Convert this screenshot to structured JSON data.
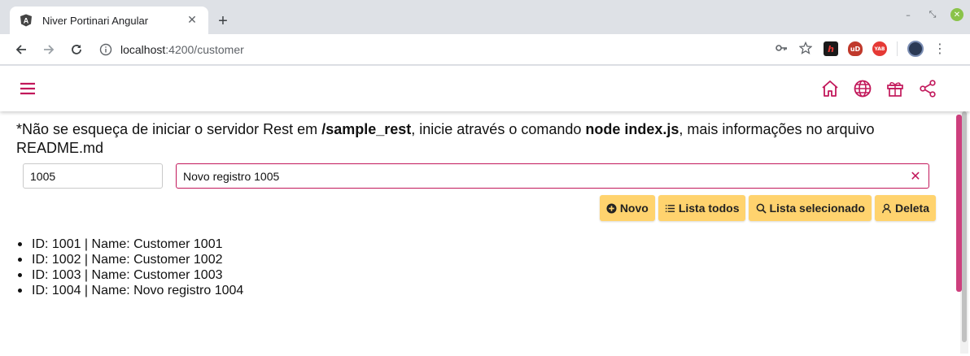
{
  "browser": {
    "tab_title": "Niver Portinari Angular",
    "tab_favicon": "angular-icon",
    "new_tab_label": "+",
    "url_host": "localhost",
    "url_path": ":4200/customer",
    "extensions": [
      {
        "name": "ext-h-icon",
        "label": "h",
        "color": "#1a1a1a"
      },
      {
        "name": "ublock-icon",
        "label": "uD",
        "color": "#c0392b"
      },
      {
        "name": "yab-icon",
        "label": "YAB",
        "color": "#e53935"
      }
    ]
  },
  "app": {
    "accent": "#c2185b",
    "appbar_icons": [
      "home-icon",
      "globe-icon",
      "gift-icon",
      "share-icon"
    ],
    "notice": {
      "prefix": "*Não se esqueça de iniciar o servidor Rest em ",
      "bold1": "/sample_rest",
      "middle": ", inicie através o comando ",
      "bold2": "node index.js",
      "suffix": ", mais informações no arquivo README.md"
    },
    "id_field_value": "1005",
    "name_field_value": "Novo registro 1005",
    "buttons": {
      "novo": "Novo",
      "lista_todos": "Lista todos",
      "lista_selecionado": "Lista selecionado",
      "deleta": "Deleta"
    },
    "button_color": "#ffd36e",
    "customers": [
      "ID: 1001 | Name: Customer 1001",
      "ID: 1002 | Name: Customer 1002",
      "ID: 1003 | Name: Customer 1003",
      "ID: 1004 | Name: Novo registro 1004"
    ]
  }
}
